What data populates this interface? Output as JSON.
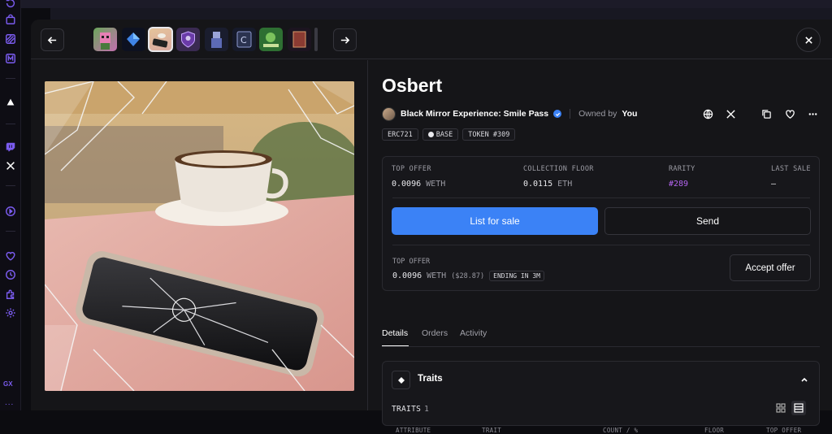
{
  "sidebar": {
    "icons": [
      "refresh-icon",
      "bag-icon",
      "stripe-icon",
      "m-badge-icon",
      "avalanche-icon",
      "twitch-icon",
      "x-logo-icon",
      "play-icon",
      "heart-icon",
      "clock-icon",
      "puzzle-icon",
      "gear-icon"
    ],
    "gx_label": "GX",
    "more": "..."
  },
  "topbar": {
    "thumbnails": [
      "pixel-character",
      "blue-gem",
      "shattered-phone",
      "shield-skull",
      "robot-figure",
      "card-c",
      "green-art",
      "red-card"
    ]
  },
  "nft": {
    "name": "Osbert",
    "collection": "Black Mirror Experience: Smile Pass",
    "owned_by_label": "Owned by",
    "owner": "You",
    "tags": [
      "ERC721",
      "BASE",
      "TOKEN #309"
    ]
  },
  "stats": {
    "top_offer_label": "TOP OFFER",
    "top_offer_value": "0.0096",
    "top_offer_unit": "WETH",
    "floor_label": "COLLECTION FLOOR",
    "floor_value": "0.0115",
    "floor_unit": "ETH",
    "rarity_label": "RARITY",
    "rarity_value": "#289",
    "last_sale_label": "LAST SALE",
    "last_sale_value": "–"
  },
  "actions": {
    "list_for_sale": "List for sale",
    "send": "Send",
    "accept_offer": "Accept offer"
  },
  "offer": {
    "label": "TOP OFFER",
    "value": "0.0096",
    "unit": "WETH",
    "usd": "($28.87)",
    "ending": "ENDING IN 3M"
  },
  "tabs": [
    "Details",
    "Orders",
    "Activity"
  ],
  "traits": {
    "title": "Traits",
    "count_label": "TRAITS",
    "count": "1",
    "columns": [
      "ATTRIBUTE",
      "TRAIT",
      "COUNT / %",
      "FLOOR",
      "TOP OFFER"
    ]
  },
  "colors": {
    "accent_blue": "#3b82f6",
    "rarity_purple": "#b565f0",
    "rail_purple": "#7b5cf0",
    "background": "#151518"
  }
}
